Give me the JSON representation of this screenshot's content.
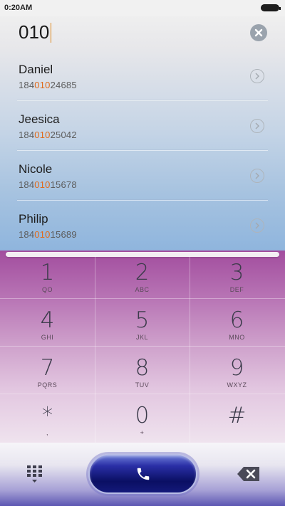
{
  "status_bar": {
    "time": "0:20AM"
  },
  "search": {
    "query": "010"
  },
  "contacts": [
    {
      "name": "Daniel",
      "number_prefix": "184",
      "number_match": "010",
      "number_suffix": "24685"
    },
    {
      "name": "Jeesica",
      "number_prefix": "184",
      "number_match": "010",
      "number_suffix": "25042"
    },
    {
      "name": "Nicole",
      "number_prefix": "184",
      "number_match": "010",
      "number_suffix": "15678"
    },
    {
      "name": "Philip",
      "number_prefix": "184",
      "number_match": "010",
      "number_suffix": "15689"
    }
  ],
  "keypad": {
    "keys": [
      {
        "digit": "1",
        "letters": "QO"
      },
      {
        "digit": "2",
        "letters": "ABC"
      },
      {
        "digit": "3",
        "letters": "DEF"
      },
      {
        "digit": "4",
        "letters": "GHI"
      },
      {
        "digit": "5",
        "letters": "JKL"
      },
      {
        "digit": "6",
        "letters": "MNO"
      },
      {
        "digit": "7",
        "letters": "PQRS"
      },
      {
        "digit": "8",
        "letters": "TUV"
      },
      {
        "digit": "9",
        "letters": "WXYZ"
      },
      {
        "digit": "*",
        "letters": ","
      },
      {
        "digit": "0",
        "letters": "+"
      },
      {
        "digit": "#",
        "letters": ""
      }
    ]
  },
  "icons": {
    "clear": "clear-icon",
    "detail": "chevron-right-circle-icon",
    "dialpad": "dialpad-grid-icon",
    "call": "phone-icon",
    "backspace": "backspace-icon"
  },
  "colors": {
    "highlight": "#e06a1a",
    "call_button": "#0a0f63"
  }
}
